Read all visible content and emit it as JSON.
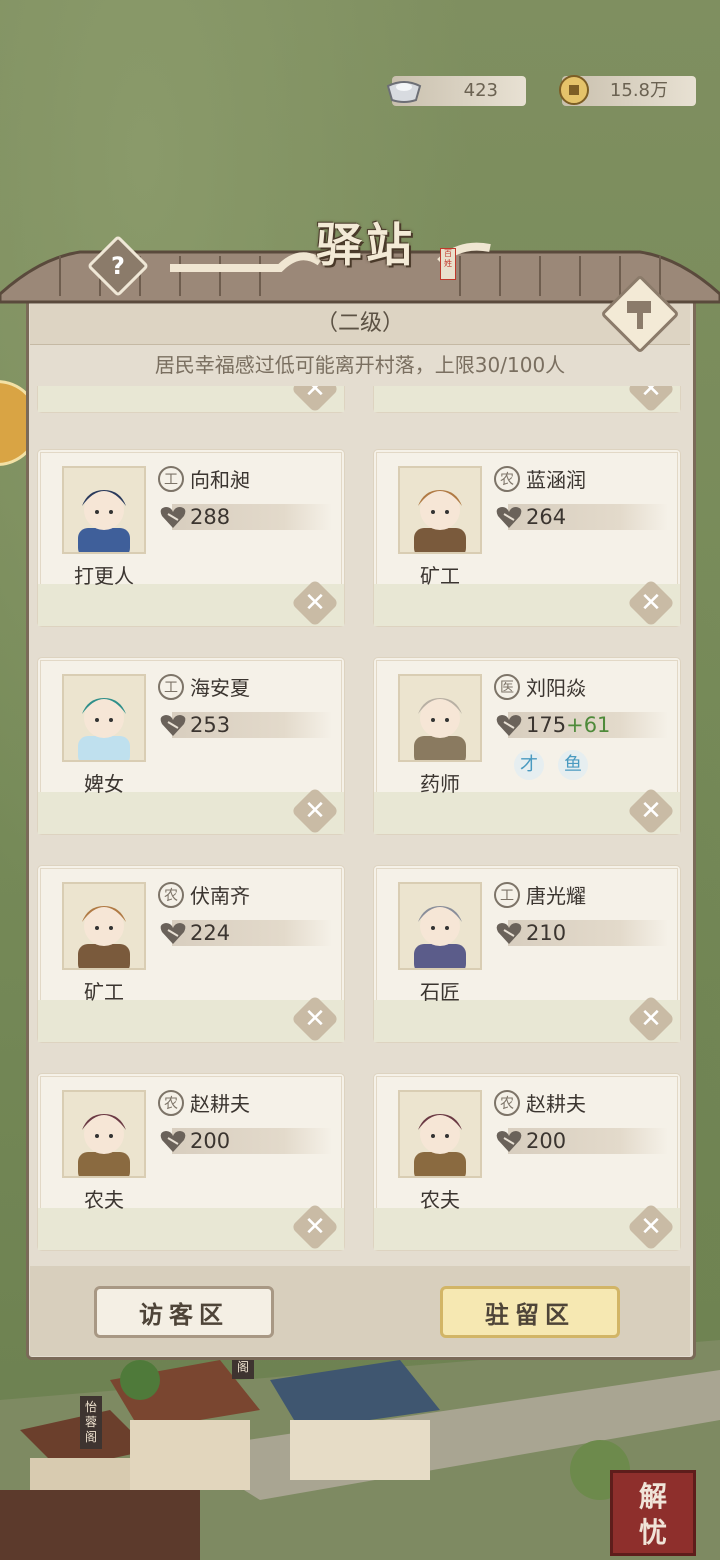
{
  "currency": {
    "silver": "423",
    "coins": "15.8万"
  },
  "header": {
    "title": "驿站",
    "seal": "百姓",
    "level": "（二级）",
    "notice": "居民幸福感过低可能离开村落，上限30/100人"
  },
  "residents": [
    {
      "badge": "工",
      "name": "向和昶",
      "happiness": "288",
      "bonus": "",
      "role": "打更人",
      "portrait": "night-watchman"
    },
    {
      "badge": "农",
      "name": "蓝涵润",
      "happiness": "264",
      "bonus": "",
      "role": "矿工",
      "portrait": "miner"
    },
    {
      "badge": "工",
      "name": "海安夏",
      "happiness": "253",
      "bonus": "",
      "role": "婢女",
      "portrait": "maid"
    },
    {
      "badge": "医",
      "name": "刘阳焱",
      "happiness": "175",
      "bonus": "+61",
      "role": "药师",
      "portrait": "pharmacist",
      "skills": [
        "才",
        "鱼"
      ]
    },
    {
      "badge": "农",
      "name": "伏南齐",
      "happiness": "224",
      "bonus": "",
      "role": "矿工",
      "portrait": "miner"
    },
    {
      "badge": "工",
      "name": "唐光耀",
      "happiness": "210",
      "bonus": "",
      "role": "石匠",
      "portrait": "mason"
    },
    {
      "badge": "农",
      "name": "赵耕夫",
      "happiness": "200",
      "bonus": "",
      "role": "农夫",
      "portrait": "farmer"
    },
    {
      "badge": "农",
      "name": "赵耕夫",
      "happiness": "200",
      "bonus": "",
      "role": "农夫",
      "portrait": "farmer"
    }
  ],
  "tabs": {
    "visitor": "访客区",
    "stay": "驻留区"
  },
  "corner": {
    "worry_line1": "解",
    "worry_line2": "忧"
  },
  "map_labels": {
    "pavilion1": "怡蓉阁",
    "pavilion2": "阁"
  },
  "icons": {
    "help": "question-icon",
    "build": "hammer-icon",
    "remove": "close-icon",
    "happiness": "heart-icon"
  },
  "colors": {
    "panel": "#e4ddd0",
    "card": "#f5f1e8",
    "bonus": "#4e8a3a",
    "stay_tab": "#f6e8b2"
  }
}
